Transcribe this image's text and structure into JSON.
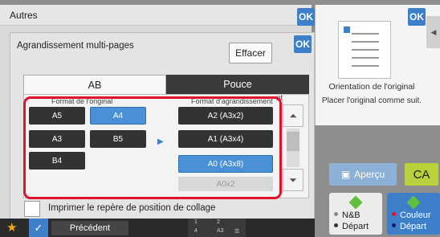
{
  "outer": {
    "title": "Autres",
    "ok": "OK"
  },
  "inner": {
    "title": "Agrandissement multi-pages",
    "ok": "OK",
    "clear": "Effacer",
    "tabs": [
      "AB",
      "Pouce"
    ],
    "headers": {
      "original_cut": "Format de l'original",
      "target_cut": "Format d'agrandissement",
      "side_cut": "nt"
    },
    "original_sizes": [
      "A5",
      "A4",
      "A3",
      "B5",
      "B4"
    ],
    "selected_original": "A4",
    "target_sizes": [
      "A2 (A3x2)",
      "A1 (A3x4)",
      "A0 (A3x8)",
      "A0x2"
    ],
    "selected_target": "A0 (A3x8)",
    "checkbox_label": "Imprimer le repère de position de collage"
  },
  "right": {
    "ok": "OK",
    "orientation_label": "Orientation de l'original",
    "instruction": "Placer l'original comme suit.",
    "preview": "Aperçu",
    "ca": "CA",
    "bw_line1": "N&B",
    "bw_line2": "Départ",
    "color_line1": "Couleur",
    "color_line2": "Départ"
  },
  "bottom": {
    "prev": "Précédent",
    "mini": [
      "1",
      "2",
      "3",
      "4",
      "A3"
    ]
  },
  "colors": {
    "accent": "#3d7fc9",
    "highlight": "#e0112b",
    "selected": "#4a90d6",
    "ca": "#b7d23a",
    "start_icon": "#5fbf3d"
  }
}
